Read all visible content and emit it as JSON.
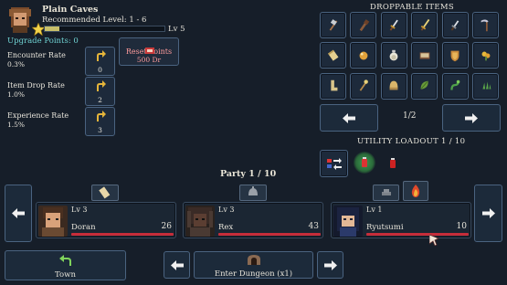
{
  "area": {
    "name": "Plain Caves",
    "recommended": "Recommended Level: 1 - 6",
    "level": "Lv 5",
    "upgrade_points_label": "Upgrade Points: 0"
  },
  "reset": {
    "label": "Reset Points",
    "cost": "500 Dr"
  },
  "rates": [
    {
      "label": "Encounter Rate",
      "value": "0.3%",
      "points": "0"
    },
    {
      "label": "Item Drop Rate",
      "value": "1.0%",
      "points": "2"
    },
    {
      "label": "Experience Rate",
      "value": "1.5%",
      "points": "3"
    }
  ],
  "drops": {
    "title": "DROPPABLE ITEMS",
    "page": "1/2",
    "items": [
      "axe-icon",
      "club-icon",
      "dagger-icon",
      "sword-icon",
      "short-sword-icon",
      "scythe-icon",
      "scroll-icon",
      "orb-icon",
      "potion-icon",
      "book-icon",
      "shield-icon",
      "herb-icon",
      "boots-icon",
      "staff-icon",
      "helmet-icon",
      "leaf-icon",
      "vine-icon",
      "claw-icon"
    ]
  },
  "utility": {
    "title": "UTILITY LOADOUT 1 / 10"
  },
  "party": {
    "title": "Party 1 / 10",
    "members": [
      {
        "name": "Doran",
        "level": "Lv 3",
        "hp": "26",
        "hp_fraction": 1.0
      },
      {
        "name": "Rex",
        "level": "Lv 3",
        "hp": "43",
        "hp_fraction": 1.0
      },
      {
        "name": "Ryutsumi",
        "level": "Lv 1",
        "hp": "10",
        "hp_fraction": 1.0
      }
    ]
  },
  "footer": {
    "town": "Town",
    "enter": "Enter Dungeon (x1)"
  },
  "colors": {
    "hp": "#c62d3a",
    "accent": "#6fd2d2",
    "panel": "#1b2633",
    "border": "#4a6380"
  }
}
